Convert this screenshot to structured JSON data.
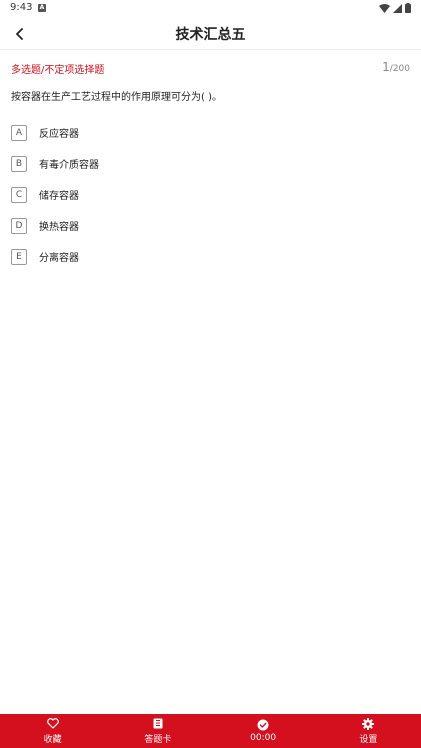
{
  "status_bar": {
    "time": "9:43",
    "notification_letter": "A"
  },
  "header": {
    "title": "技术汇总五"
  },
  "question": {
    "type_label": "多选题/不定项选择题",
    "current": "1",
    "total": "/200",
    "text": "按容器在生产工艺过程中的作用原理可分为( )。",
    "options": [
      {
        "letter": "A",
        "text": "反应容器"
      },
      {
        "letter": "B",
        "text": "有毒介质容器"
      },
      {
        "letter": "C",
        "text": "储存容器"
      },
      {
        "letter": "D",
        "text": "换热容器"
      },
      {
        "letter": "E",
        "text": "分离容器"
      }
    ]
  },
  "bottom_bar": {
    "tabs": [
      {
        "label": "收藏",
        "icon": "heart-icon"
      },
      {
        "label": "答题卡",
        "icon": "answer-sheet-icon"
      },
      {
        "label": "00:00",
        "icon": "timer-check-icon"
      },
      {
        "label": "设置",
        "icon": "gear-icon"
      }
    ]
  },
  "colors": {
    "accent": "#d40f1e",
    "type_label": "#d0121b"
  }
}
